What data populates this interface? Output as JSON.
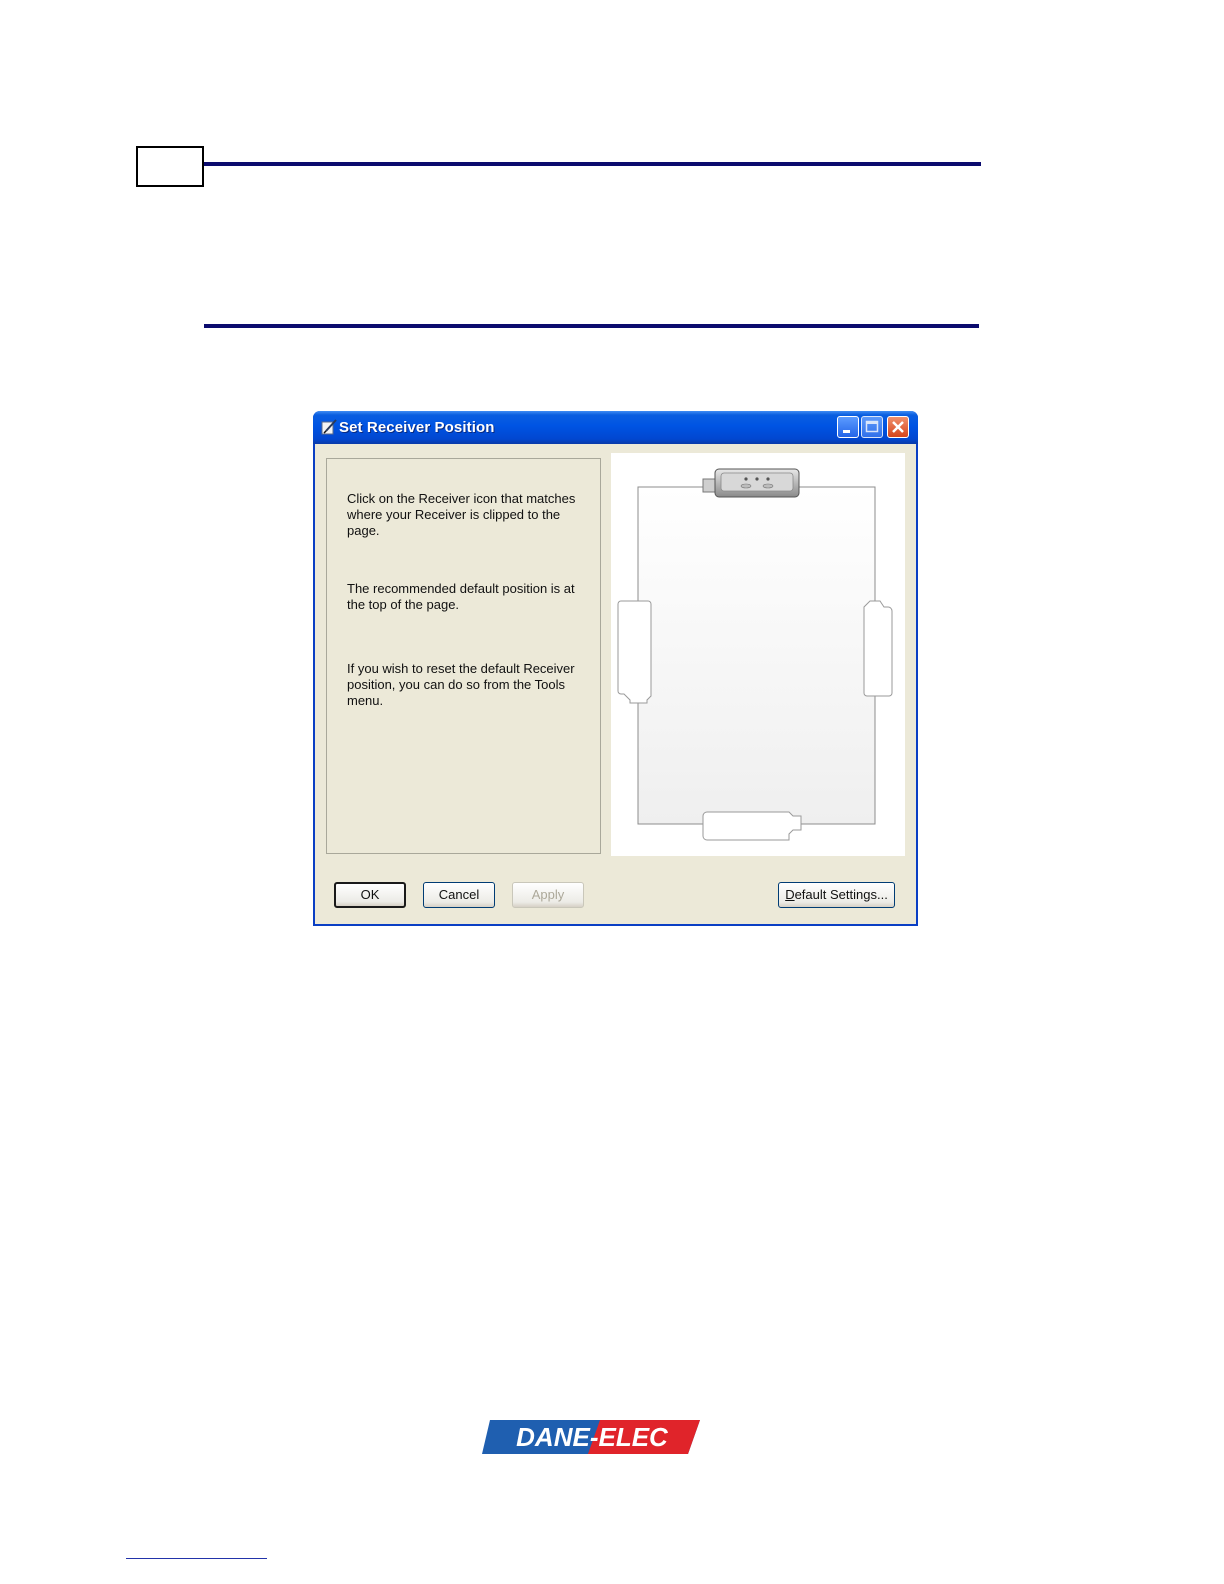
{
  "dialog": {
    "title": "Set Receiver Position",
    "instructions": [
      "Click on the Receiver icon that matches where your Receiver is clipped to the page.",
      "The recommended default position is at the top of the page.",
      "If you wish to reset the default Receiver position, you can do so from the Tools menu."
    ],
    "buttons": {
      "ok": "OK",
      "cancel": "Cancel",
      "apply": "Apply",
      "default_settings_first": "D",
      "default_settings_rest": "efault Settings..."
    },
    "receiver_positions": [
      "top",
      "left",
      "right",
      "bottom"
    ],
    "selected_position": "top"
  },
  "brand": {
    "logo_text": "DANE-ELEC",
    "logo_color": "#1f5fb0",
    "logo_accent": "#e0242a"
  },
  "colors": {
    "titlebar": "#0054e3",
    "dialog_bg": "#ece9d8",
    "rule": "#0b0b6e"
  }
}
